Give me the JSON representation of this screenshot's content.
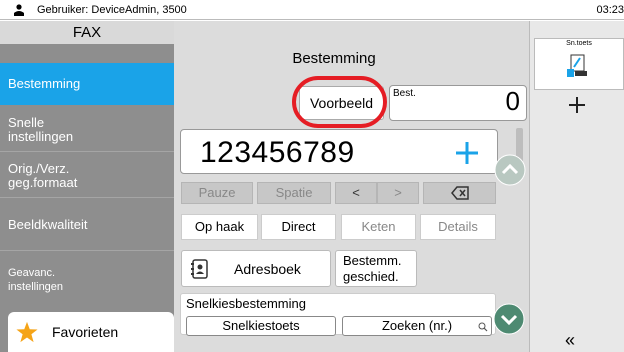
{
  "status": {
    "user_text": "Gebruiker: DeviceAdmin, 3500",
    "time": "03:23"
  },
  "left": {
    "title": "FAX",
    "items": [
      {
        "label": "Bestemming",
        "active": true
      },
      {
        "label": "Snelle\ninstellingen",
        "active": false
      },
      {
        "label": "Orig./Verz.\ngeg.formaat",
        "active": false
      },
      {
        "label": "Beeldkwaliteit",
        "active": false
      },
      {
        "label": "Geavanc.\ninstellingen",
        "active": false
      }
    ],
    "favorites": "Favorieten"
  },
  "center": {
    "title": "Bestemming",
    "preview_label": "Voorbeeld",
    "best_label": "Best.",
    "best_count": "0",
    "number": "123456789",
    "keys": {
      "pause": "Pauze",
      "space": "Spatie",
      "left": "<",
      "right": ">"
    },
    "modes": {
      "onhook": "Op haak",
      "direct": "Direct",
      "chain": "Keten",
      "details": "Details"
    },
    "address_book": "Adresboek",
    "history": "Bestemm.\ngeschied.",
    "quick_title": "Snelkiesbestemming",
    "quick_key": "Snelkiestoets",
    "search_nr": "Zoeken (nr.)"
  },
  "right": {
    "tab_label": "Sn.toets",
    "collapse": "«"
  },
  "colors": {
    "accent": "#1aa3e8",
    "highlight_ring": "#e51d24",
    "scroll_button": "#8fb9a9"
  }
}
